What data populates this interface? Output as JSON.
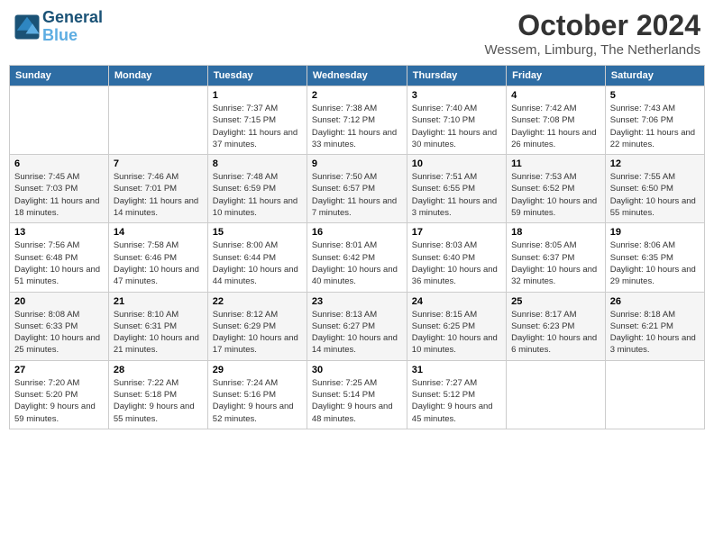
{
  "header": {
    "logo_line1": "General",
    "logo_line2": "Blue",
    "month": "October 2024",
    "location": "Wessem, Limburg, The Netherlands"
  },
  "weekdays": [
    "Sunday",
    "Monday",
    "Tuesday",
    "Wednesday",
    "Thursday",
    "Friday",
    "Saturday"
  ],
  "weeks": [
    [
      {
        "day": "",
        "detail": ""
      },
      {
        "day": "",
        "detail": ""
      },
      {
        "day": "1",
        "detail": "Sunrise: 7:37 AM\nSunset: 7:15 PM\nDaylight: 11 hours and 37 minutes."
      },
      {
        "day": "2",
        "detail": "Sunrise: 7:38 AM\nSunset: 7:12 PM\nDaylight: 11 hours and 33 minutes."
      },
      {
        "day": "3",
        "detail": "Sunrise: 7:40 AM\nSunset: 7:10 PM\nDaylight: 11 hours and 30 minutes."
      },
      {
        "day": "4",
        "detail": "Sunrise: 7:42 AM\nSunset: 7:08 PM\nDaylight: 11 hours and 26 minutes."
      },
      {
        "day": "5",
        "detail": "Sunrise: 7:43 AM\nSunset: 7:06 PM\nDaylight: 11 hours and 22 minutes."
      }
    ],
    [
      {
        "day": "6",
        "detail": "Sunrise: 7:45 AM\nSunset: 7:03 PM\nDaylight: 11 hours and 18 minutes."
      },
      {
        "day": "7",
        "detail": "Sunrise: 7:46 AM\nSunset: 7:01 PM\nDaylight: 11 hours and 14 minutes."
      },
      {
        "day": "8",
        "detail": "Sunrise: 7:48 AM\nSunset: 6:59 PM\nDaylight: 11 hours and 10 minutes."
      },
      {
        "day": "9",
        "detail": "Sunrise: 7:50 AM\nSunset: 6:57 PM\nDaylight: 11 hours and 7 minutes."
      },
      {
        "day": "10",
        "detail": "Sunrise: 7:51 AM\nSunset: 6:55 PM\nDaylight: 11 hours and 3 minutes."
      },
      {
        "day": "11",
        "detail": "Sunrise: 7:53 AM\nSunset: 6:52 PM\nDaylight: 10 hours and 59 minutes."
      },
      {
        "day": "12",
        "detail": "Sunrise: 7:55 AM\nSunset: 6:50 PM\nDaylight: 10 hours and 55 minutes."
      }
    ],
    [
      {
        "day": "13",
        "detail": "Sunrise: 7:56 AM\nSunset: 6:48 PM\nDaylight: 10 hours and 51 minutes."
      },
      {
        "day": "14",
        "detail": "Sunrise: 7:58 AM\nSunset: 6:46 PM\nDaylight: 10 hours and 47 minutes."
      },
      {
        "day": "15",
        "detail": "Sunrise: 8:00 AM\nSunset: 6:44 PM\nDaylight: 10 hours and 44 minutes."
      },
      {
        "day": "16",
        "detail": "Sunrise: 8:01 AM\nSunset: 6:42 PM\nDaylight: 10 hours and 40 minutes."
      },
      {
        "day": "17",
        "detail": "Sunrise: 8:03 AM\nSunset: 6:40 PM\nDaylight: 10 hours and 36 minutes."
      },
      {
        "day": "18",
        "detail": "Sunrise: 8:05 AM\nSunset: 6:37 PM\nDaylight: 10 hours and 32 minutes."
      },
      {
        "day": "19",
        "detail": "Sunrise: 8:06 AM\nSunset: 6:35 PM\nDaylight: 10 hours and 29 minutes."
      }
    ],
    [
      {
        "day": "20",
        "detail": "Sunrise: 8:08 AM\nSunset: 6:33 PM\nDaylight: 10 hours and 25 minutes."
      },
      {
        "day": "21",
        "detail": "Sunrise: 8:10 AM\nSunset: 6:31 PM\nDaylight: 10 hours and 21 minutes."
      },
      {
        "day": "22",
        "detail": "Sunrise: 8:12 AM\nSunset: 6:29 PM\nDaylight: 10 hours and 17 minutes."
      },
      {
        "day": "23",
        "detail": "Sunrise: 8:13 AM\nSunset: 6:27 PM\nDaylight: 10 hours and 14 minutes."
      },
      {
        "day": "24",
        "detail": "Sunrise: 8:15 AM\nSunset: 6:25 PM\nDaylight: 10 hours and 10 minutes."
      },
      {
        "day": "25",
        "detail": "Sunrise: 8:17 AM\nSunset: 6:23 PM\nDaylight: 10 hours and 6 minutes."
      },
      {
        "day": "26",
        "detail": "Sunrise: 8:18 AM\nSunset: 6:21 PM\nDaylight: 10 hours and 3 minutes."
      }
    ],
    [
      {
        "day": "27",
        "detail": "Sunrise: 7:20 AM\nSunset: 5:20 PM\nDaylight: 9 hours and 59 minutes."
      },
      {
        "day": "28",
        "detail": "Sunrise: 7:22 AM\nSunset: 5:18 PM\nDaylight: 9 hours and 55 minutes."
      },
      {
        "day": "29",
        "detail": "Sunrise: 7:24 AM\nSunset: 5:16 PM\nDaylight: 9 hours and 52 minutes."
      },
      {
        "day": "30",
        "detail": "Sunrise: 7:25 AM\nSunset: 5:14 PM\nDaylight: 9 hours and 48 minutes."
      },
      {
        "day": "31",
        "detail": "Sunrise: 7:27 AM\nSunset: 5:12 PM\nDaylight: 9 hours and 45 minutes."
      },
      {
        "day": "",
        "detail": ""
      },
      {
        "day": "",
        "detail": ""
      }
    ]
  ]
}
